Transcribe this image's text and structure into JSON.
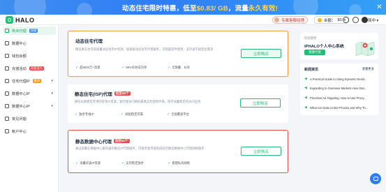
{
  "banner": {
    "prefix": "动态住宅限时特惠，低至",
    "highlight": "$0.83/ GB",
    "middle": "，流量",
    "highlight2": "永久有效!"
  },
  "header": {
    "logo": "HALO",
    "advisor_label": "专属客服经理",
    "balance_label": "余额：",
    "balance_value": "$0",
    "lang": "简中"
  },
  "sidebar": {
    "items": [
      {
        "label": "购买代理",
        "tag": "快速"
      },
      {
        "label": "数据中心"
      },
      {
        "label": "钱包余额"
      },
      {
        "label": "充值活动",
        "tag": "充值送礼"
      },
      {
        "label": "住宅代理IP",
        "tag": "推荐"
      },
      {
        "label": "数据中心IP"
      },
      {
        "label": "数据中心IP"
      },
      {
        "label": "常见问题"
      },
      {
        "label": "帐户中心"
      }
    ]
  },
  "cards": [
    {
      "title": "动态住宅代理",
      "desc": "精选真实住宅高质量动态住宅IP资源，国家级动态住宅代理服务，可搭配软件使用，支持城市级定位需求",
      "features": [
        "超9000万+资源",
        "99%有效成功率",
        "无限量、长效"
      ],
      "button": "立即购买"
    },
    {
      "title": "静态住宅(ISP)代理",
      "tag": "低至$5/个",
      "desc": "拥有长期稳定专用的住宅IP资源，使代理访问拥有最真实的使用环境，保持海量稳定的访问应用",
      "features": [
        "独享专线IP",
        "高配稳定可靠",
        "全面覆盖平台"
      ],
      "button": "立即购买"
    },
    {
      "title": "静态数据中心代理",
      "tag": "低至$1/个",
      "desc": "通过部署在数据中心服务器的静态IP代理服务，可独享高带宽的低延迟静态数据中心代理网络服务",
      "features": [
        "海量优质IP资源",
        "支持稳定独享",
        "搭建私有网络"
      ],
      "button": "立即购买"
    }
  ],
  "promo": {
    "small": "欢迎使用",
    "title": "IPHALO个人中心系统",
    "button": "我要代理"
  },
  "news": {
    "title": "新闻资讯",
    "more": "查看更多",
    "items": [
      "A Practical Guide to Using Dynamic Resid...",
      "Expanding to Overseas Markets How Stat...",
      "Precision Ad Targeting: How to Use Proxy...",
      "What Are Data Center Proxies and Why Th..."
    ]
  },
  "colors": {
    "accent": "#1fbf75",
    "banner": "#2f7df6",
    "highlight": "#ffd84a",
    "danger": "#e85050",
    "warn": "#f3a342"
  }
}
